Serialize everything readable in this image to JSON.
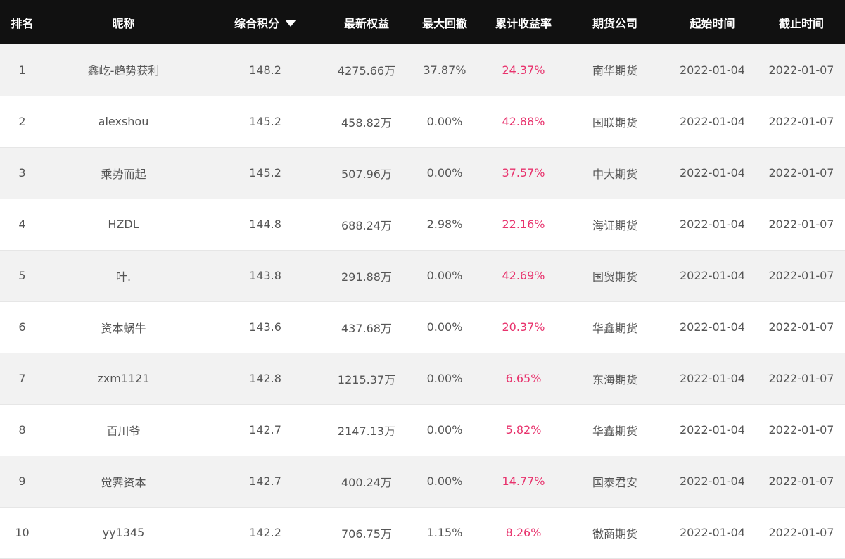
{
  "table": {
    "headers": {
      "rank": "排名",
      "nickname": "昵称",
      "score": "综合积分",
      "equity": "最新权益",
      "max_drawdown": "最大回撤",
      "cumulative_return": "累计收益率",
      "company": "期货公司",
      "start_time": "起始时间",
      "end_time": "截止时间"
    },
    "sort": {
      "column": "score",
      "direction": "descending",
      "icon": "triangle-down-icon"
    },
    "rows": [
      {
        "rank": "1",
        "nickname": "鑫屹-趋势获利",
        "score": "148.2",
        "equity": "4275.66万",
        "max_drawdown": "37.87%",
        "cumulative_return": "24.37%",
        "company": "南华期货",
        "start_time": "2022-01-04",
        "end_time": "2022-01-07"
      },
      {
        "rank": "2",
        "nickname": "alexshou",
        "score": "145.2",
        "equity": "458.82万",
        "max_drawdown": "0.00%",
        "cumulative_return": "42.88%",
        "company": "国联期货",
        "start_time": "2022-01-04",
        "end_time": "2022-01-07"
      },
      {
        "rank": "3",
        "nickname": "乘势而起",
        "score": "145.2",
        "equity": "507.96万",
        "max_drawdown": "0.00%",
        "cumulative_return": "37.57%",
        "company": "中大期货",
        "start_time": "2022-01-04",
        "end_time": "2022-01-07"
      },
      {
        "rank": "4",
        "nickname": "HZDL",
        "score": "144.8",
        "equity": "688.24万",
        "max_drawdown": "2.98%",
        "cumulative_return": "22.16%",
        "company": "海证期货",
        "start_time": "2022-01-04",
        "end_time": "2022-01-07"
      },
      {
        "rank": "5",
        "nickname": "叶.",
        "score": "143.8",
        "equity": "291.88万",
        "max_drawdown": "0.00%",
        "cumulative_return": "42.69%",
        "company": "国贸期货",
        "start_time": "2022-01-04",
        "end_time": "2022-01-07"
      },
      {
        "rank": "6",
        "nickname": "资本蜗牛",
        "score": "143.6",
        "equity": "437.68万",
        "max_drawdown": "0.00%",
        "cumulative_return": "20.37%",
        "company": "华鑫期货",
        "start_time": "2022-01-04",
        "end_time": "2022-01-07"
      },
      {
        "rank": "7",
        "nickname": "zxm1121",
        "score": "142.8",
        "equity": "1215.37万",
        "max_drawdown": "0.00%",
        "cumulative_return": "6.65%",
        "company": "东海期货",
        "start_time": "2022-01-04",
        "end_time": "2022-01-07"
      },
      {
        "rank": "8",
        "nickname": "百川爷",
        "score": "142.7",
        "equity": "2147.13万",
        "max_drawdown": "0.00%",
        "cumulative_return": "5.82%",
        "company": "华鑫期货",
        "start_time": "2022-01-04",
        "end_time": "2022-01-07"
      },
      {
        "rank": "9",
        "nickname": "觉霁资本",
        "score": "142.7",
        "equity": "400.24万",
        "max_drawdown": "0.00%",
        "cumulative_return": "14.77%",
        "company": "国泰君安",
        "start_time": "2022-01-04",
        "end_time": "2022-01-07"
      },
      {
        "rank": "10",
        "nickname": "yy1345",
        "score": "142.2",
        "equity": "706.75万",
        "max_drawdown": "1.15%",
        "cumulative_return": "8.26%",
        "company": "徽商期货",
        "start_time": "2022-01-04",
        "end_time": "2022-01-07"
      }
    ]
  },
  "colors": {
    "header_bg": "#111111",
    "header_text": "#ffffff",
    "row_odd_bg": "#f2f2f2",
    "row_even_bg": "#ffffff",
    "text": "#555555",
    "return_accent": "#e8336d"
  }
}
